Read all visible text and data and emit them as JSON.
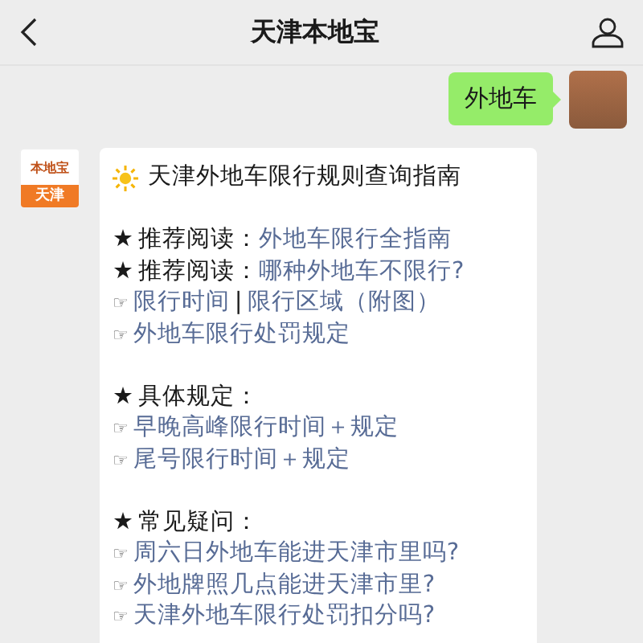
{
  "header": {
    "title": "天津本地宝"
  },
  "outgoing": {
    "text": "外地车"
  },
  "incoming": {
    "avatar": {
      "brand": "本地宝",
      "city": "天津"
    },
    "title": "天津外地车限行规则查询指南",
    "lines": [
      {
        "kind": "gap"
      },
      {
        "kind": "line",
        "bullet": "★",
        "parts": [
          {
            "kind": "label",
            "text": "推荐阅读："
          },
          {
            "kind": "link",
            "text": "外地车限行全指南"
          }
        ]
      },
      {
        "kind": "line",
        "bullet": "★",
        "parts": [
          {
            "kind": "label",
            "text": "推荐阅读："
          },
          {
            "kind": "link",
            "text": "哪种外地车不限行?"
          }
        ]
      },
      {
        "kind": "line",
        "bullet": "☞",
        "parts": [
          {
            "kind": "link",
            "text": "限行时间"
          },
          {
            "kind": "label",
            "text": "|"
          },
          {
            "kind": "link",
            "text": "限行区域（附图）"
          }
        ]
      },
      {
        "kind": "line",
        "bullet": "☞",
        "parts": [
          {
            "kind": "link",
            "text": "外地车限行处罚规定"
          }
        ]
      },
      {
        "kind": "gap"
      },
      {
        "kind": "line",
        "bullet": "★",
        "parts": [
          {
            "kind": "label",
            "text": "具体规定："
          }
        ]
      },
      {
        "kind": "line",
        "bullet": "☞",
        "parts": [
          {
            "kind": "link",
            "text": "早晚高峰限行时间＋规定"
          }
        ]
      },
      {
        "kind": "line",
        "bullet": "☞",
        "parts": [
          {
            "kind": "link",
            "text": "尾号限行时间＋规定"
          }
        ]
      },
      {
        "kind": "gap"
      },
      {
        "kind": "line",
        "bullet": "★",
        "parts": [
          {
            "kind": "label",
            "text": "常见疑问："
          }
        ]
      },
      {
        "kind": "line",
        "bullet": "☞",
        "parts": [
          {
            "kind": "link",
            "text": "周六日外地车能进天津市里吗?"
          }
        ]
      },
      {
        "kind": "line",
        "bullet": "☞",
        "parts": [
          {
            "kind": "link",
            "text": "外地牌照几点能进天津市里?"
          }
        ]
      },
      {
        "kind": "line",
        "bullet": "☞",
        "parts": [
          {
            "kind": "link",
            "text": "天津外地车限行处罚扣分吗?"
          }
        ]
      }
    ]
  }
}
